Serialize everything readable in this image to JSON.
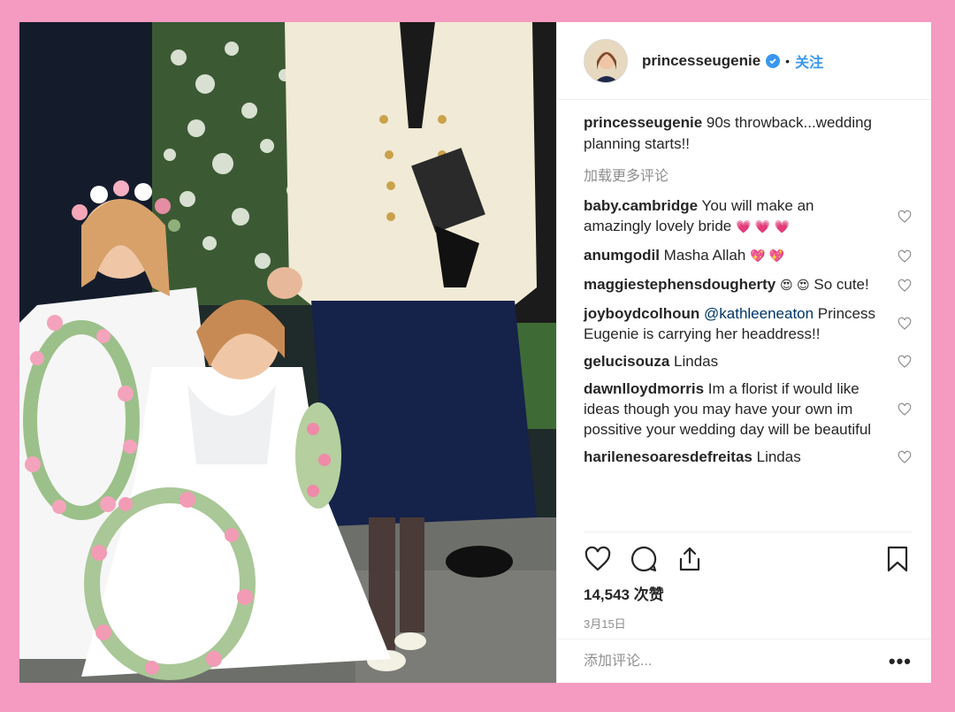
{
  "colors": {
    "background": "#f59ac0",
    "accent": "#3897f0",
    "muted": "#8e8e8e"
  },
  "header": {
    "username": "princesseugenie",
    "dot": "•",
    "follow_label": "关注"
  },
  "caption": {
    "username": "princesseugenie",
    "text": " 90s throwback...wedding planning starts!!"
  },
  "load_more": "加载更多评论",
  "comments": [
    {
      "user": "baby.cambridge",
      "text": " You will make an amazingly lovely bride ",
      "emoji": "💗 💗 💗"
    },
    {
      "user": "anumgodil",
      "text": " Masha Allah ",
      "emoji": "💖 💖"
    },
    {
      "user": "maggiestephensdougherty",
      "text": " ",
      "emoji": "😍 😍",
      "text2": "  So cute!"
    },
    {
      "user": "joyboydcolhoun",
      "mention": " @kathleeneaton",
      "text": " Princess Eugenie is carrying her headdress!!"
    },
    {
      "user": "gelucisouza",
      "text": " Lindas"
    },
    {
      "user": "dawnlloydmorris",
      "text": " Im a florist if would like ideas though you may have your own im possitive your wedding day will be beautiful"
    },
    {
      "user": "harilenesoaresdefreitas",
      "text": " Lindas"
    }
  ],
  "likes": "14,543 次赞",
  "date": "3月15日",
  "add_comment": {
    "placeholder": "添加评论..."
  },
  "more_options": "•••",
  "icons": [
    "heart-icon",
    "comment-icon",
    "share-icon",
    "bookmark-icon",
    "verified-icon"
  ]
}
